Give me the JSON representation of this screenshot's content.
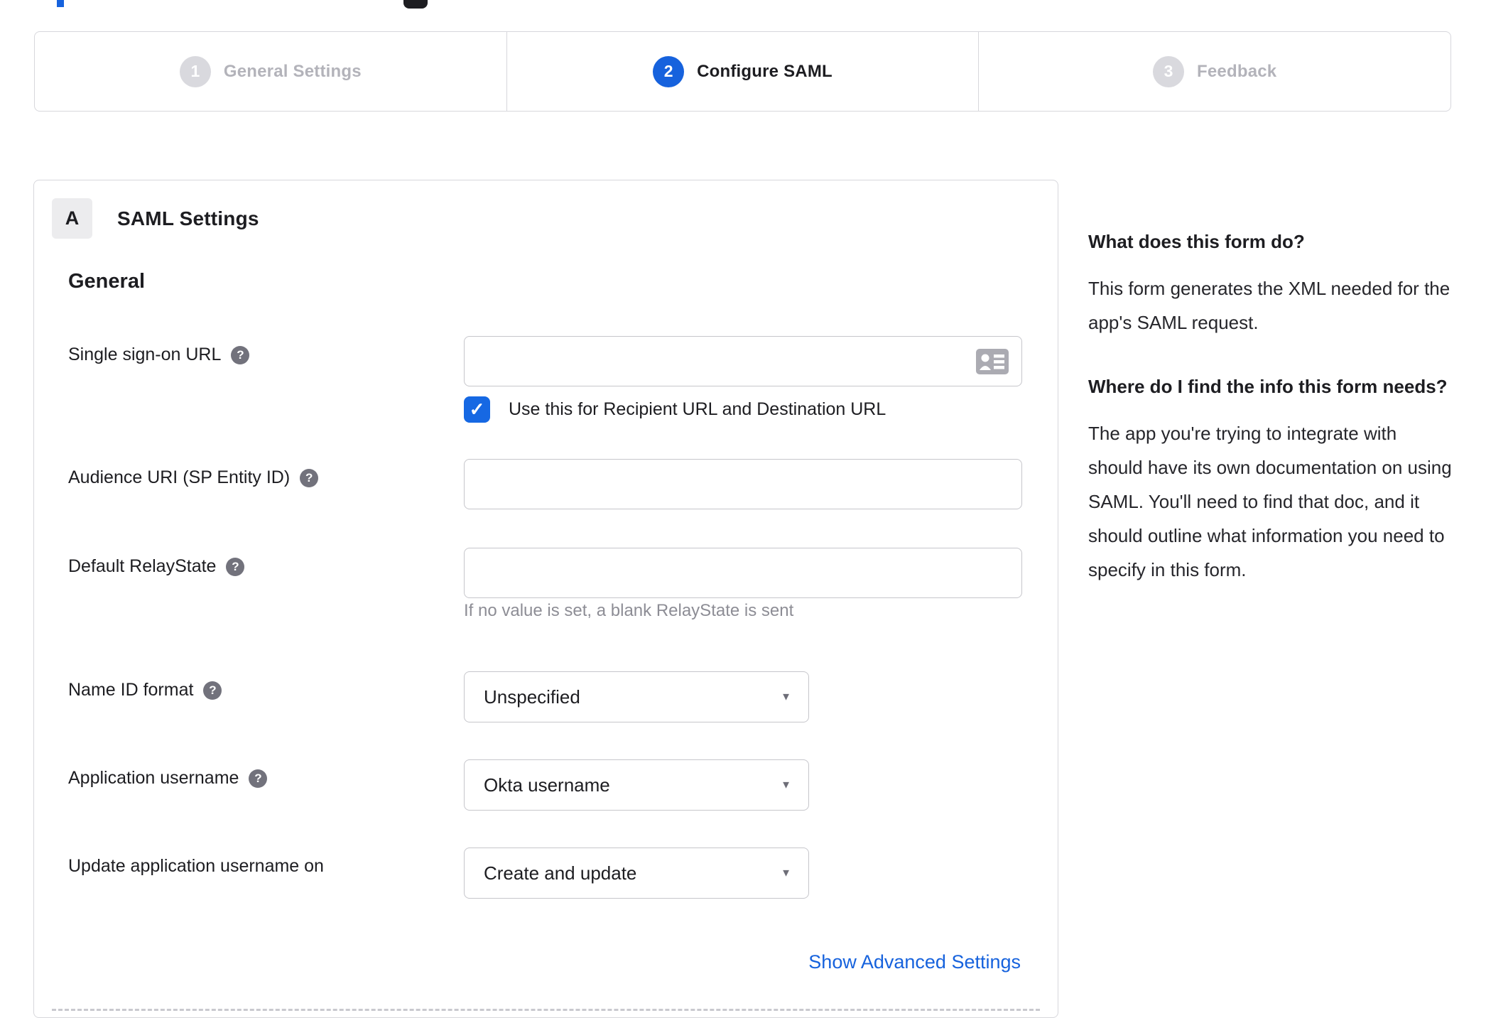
{
  "colors": {
    "accent_blue": "#1662dd",
    "border_gray": "#d7d7dc"
  },
  "wizard": {
    "steps": [
      {
        "number": "1",
        "label": "General Settings",
        "active": false
      },
      {
        "number": "2",
        "label": "Configure SAML",
        "active": true
      },
      {
        "number": "3",
        "label": "Feedback",
        "active": false
      }
    ]
  },
  "form": {
    "badge": "A",
    "title": "SAML Settings",
    "section": "General",
    "fields": {
      "sso": {
        "label": "Single sign-on URL",
        "value": "",
        "checkbox_label": "Use this for Recipient URL and Destination URL",
        "checked": true
      },
      "audience": {
        "label": "Audience URI (SP Entity ID)",
        "value": ""
      },
      "relay": {
        "label": "Default RelayState",
        "value": "",
        "hint": "If no value is set, a blank RelayState is sent"
      },
      "name_id": {
        "label": "Name ID format",
        "value": "Unspecified"
      },
      "app_username": {
        "label": "Application username",
        "value": "Okta username"
      },
      "update_username": {
        "label": "Update application username on",
        "value": "Create and update"
      }
    },
    "advanced_link": "Show Advanced Settings"
  },
  "sidebar": {
    "heading1": "What does this form do?",
    "para1": "This form generates the XML needed for the app's SAML request.",
    "heading2": "Where do I find the info this form needs?",
    "para2": "The app you're trying to integrate with should have its own documentation on using SAML. You'll need to find that doc, and it should outline what information you need to specify in this form."
  },
  "icons": {
    "help": "?",
    "check": "✓",
    "caret": "▼"
  }
}
